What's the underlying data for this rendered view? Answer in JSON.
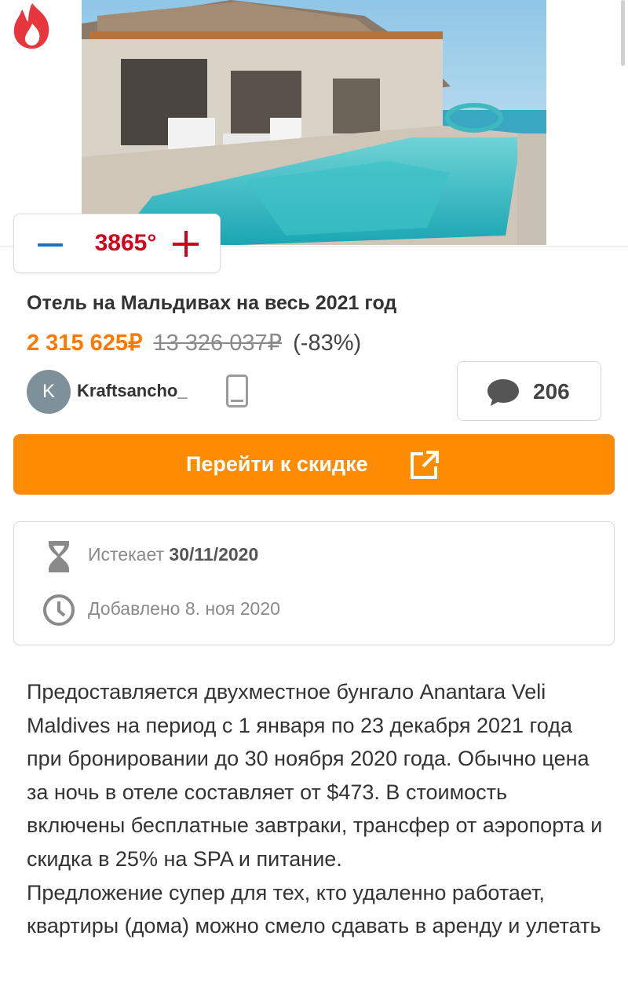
{
  "deal": {
    "temperature": "3865°",
    "title": "Отель на Мальдивах на весь 2021 год",
    "price": "2 315 625₽",
    "old_price": "13 326 037₽",
    "discount": "(-83%)"
  },
  "user": {
    "initial": "K",
    "name": "Kraftsancho_"
  },
  "comments": {
    "count": "206"
  },
  "cta": {
    "label": "Перейти к скидке"
  },
  "info": {
    "expires_label": "Истекает",
    "expires_date": "30/11/2020",
    "added": "Добавлено 8. ноя 2020"
  },
  "description": [
    "Предоставляется двухместное бунгало Anantara Veli Maldives на период с 1 января по 23 декабря 2021 года при бронировании до 30 ноября 2020 года. Обычно цена за ночь в отеле составляет от $473. В стоимость включены бесплатные завтраки, трансфер от аэропорта и скидка в 25% на SPA и питание.",
    "Предложение супер для тех, кто удаленно работает, квартиры (дома) можно смело сдавать в аренду и улетать"
  ],
  "colors": {
    "accent": "#ff8c00",
    "price": "#ff7900",
    "temperature": "#d0021b",
    "minus": "#1b73c7"
  },
  "icons": [
    "flame-icon",
    "phone-icon",
    "comment-icon",
    "external-link-icon",
    "hourglass-icon",
    "clock-icon"
  ]
}
